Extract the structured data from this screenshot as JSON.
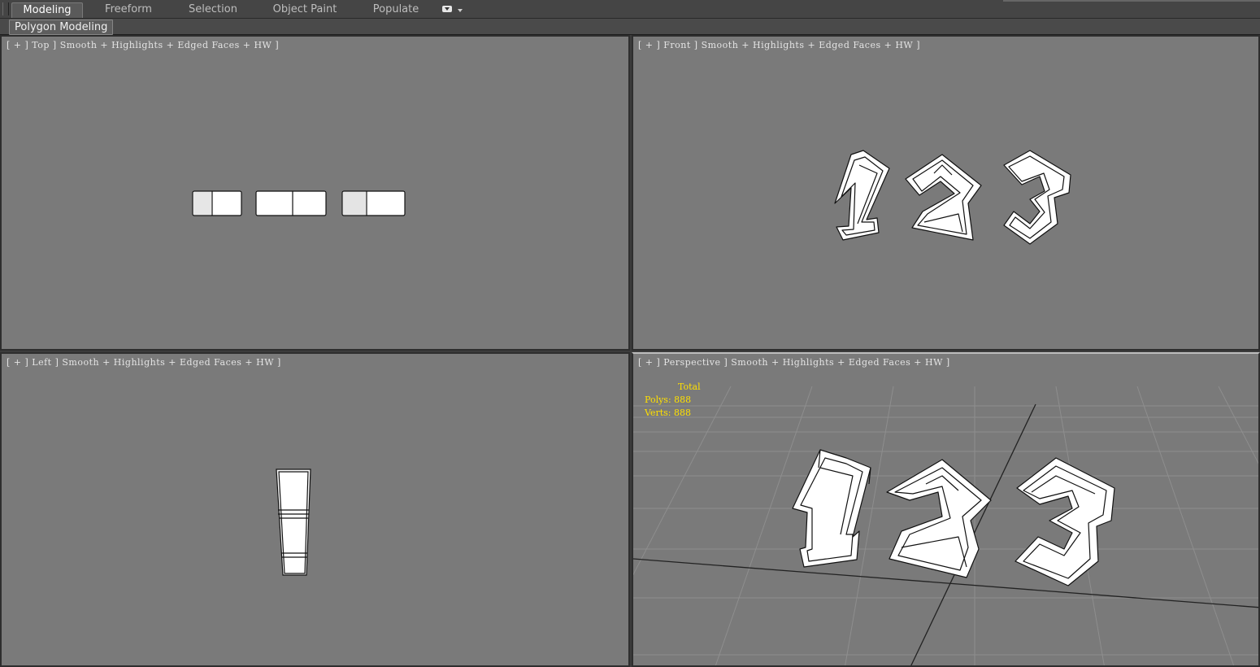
{
  "ribbon": {
    "tabs": [
      {
        "label": "Modeling",
        "active": true
      },
      {
        "label": "Freeform",
        "active": false
      },
      {
        "label": "Selection",
        "active": false
      },
      {
        "label": "Object Paint",
        "active": false
      },
      {
        "label": "Populate",
        "active": false
      }
    ],
    "overflow_icon": "dropdown-icon",
    "panel_label": "Polygon Modeling"
  },
  "viewports": {
    "top": {
      "label": "[ + ] Top ] Smooth + Highlights + Edged Faces + HW ]"
    },
    "front": {
      "label": "[ + ] Front ] Smooth + Highlights + Edged Faces + HW ]"
    },
    "left": {
      "label": "[ + ] Left ] Smooth + Highlights + Edged Faces + HW ]"
    },
    "perspective": {
      "label": "[ + ] Perspective ] Smooth + Highlights + Edged Faces + HW ]",
      "stats": {
        "header": "Total",
        "polys": "Polys: 888",
        "verts": "Verts: 888"
      }
    }
  },
  "colors": {
    "viewport_bg": "#7a7a7a",
    "stats_text": "#ffe000",
    "mesh_fill": "#ffffff",
    "mesh_edge": "#111111"
  }
}
